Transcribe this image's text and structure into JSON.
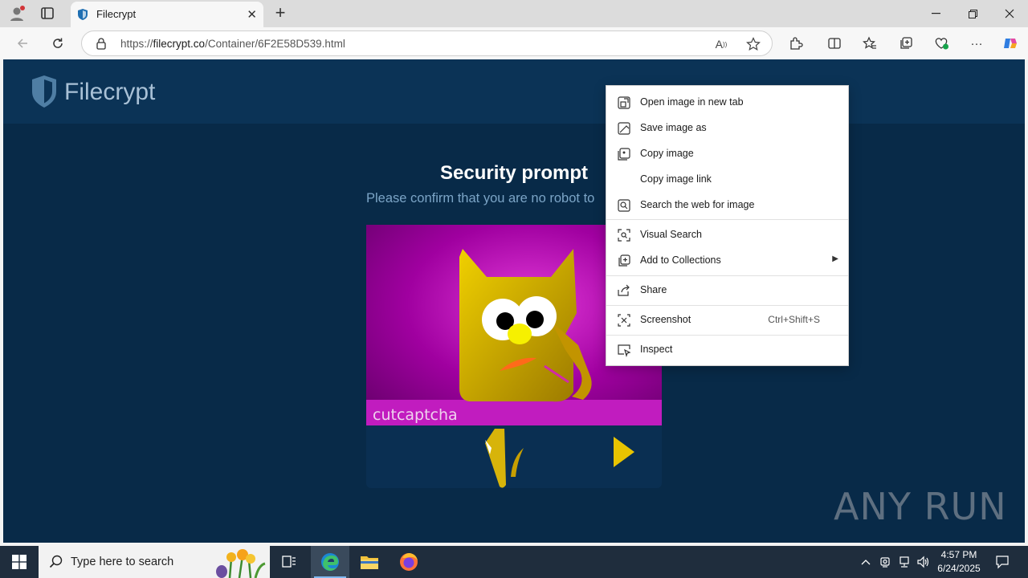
{
  "browser": {
    "tab_title": "Filecrypt",
    "url_prefix": "https://",
    "url_domain": "filecrypt.co",
    "url_path": "/Container/6F2E58D539.html",
    "accent": "#0078d4"
  },
  "page": {
    "logo_text": "Filecrypt",
    "title": "Security prompt",
    "subtitle": "Please confirm that you are no robot to",
    "captcha_brand": "cutcaptcha",
    "bg_color": "#082a48"
  },
  "context_menu": {
    "items": [
      {
        "label": "Open image in new tab",
        "icon": "open-new-tab-icon"
      },
      {
        "label": "Save image as",
        "icon": "save-image-icon"
      },
      {
        "label": "Copy image",
        "icon": "copy-image-icon"
      },
      {
        "label": "Copy image link",
        "icon": ""
      },
      {
        "label": "Search the web for image",
        "icon": "search-web-icon"
      },
      {
        "label": "Visual Search",
        "icon": "visual-search-icon"
      },
      {
        "label": "Add to Collections",
        "icon": "collections-icon"
      },
      {
        "label": "Share",
        "icon": "share-icon"
      },
      {
        "label": "Screenshot",
        "icon": "screenshot-icon",
        "shortcut": "Ctrl+Shift+S"
      },
      {
        "label": "Inspect",
        "icon": "inspect-icon"
      }
    ]
  },
  "watermark": "ANY RUN",
  "taskbar": {
    "search_placeholder": "Type here to search",
    "time": "4:57 PM",
    "date": "6/24/2025"
  }
}
